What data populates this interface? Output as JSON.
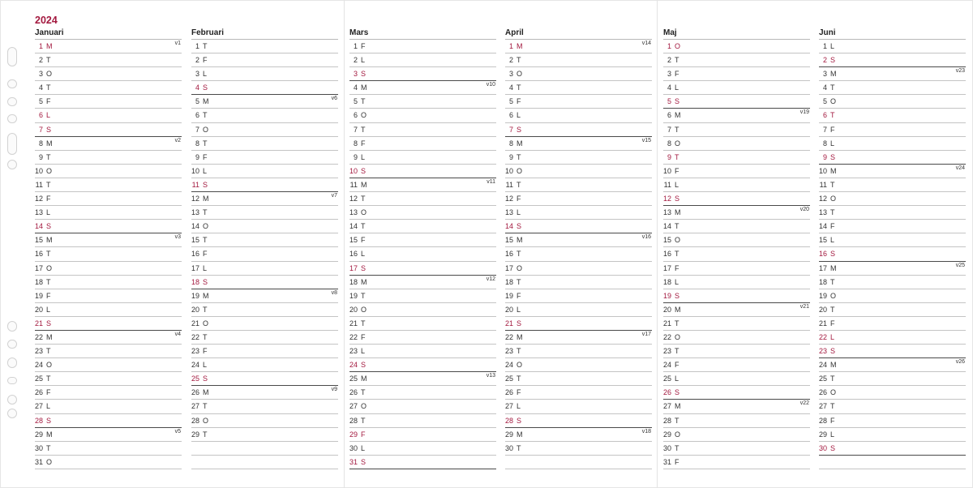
{
  "year": "2024",
  "colors": {
    "accent": "#a3193f",
    "text": "#333333"
  },
  "months": [
    {
      "name": "Januari",
      "days": [
        {
          "n": "1",
          "wd": "M",
          "red": true,
          "week": "v1"
        },
        {
          "n": "2",
          "wd": "T"
        },
        {
          "n": "3",
          "wd": "O"
        },
        {
          "n": "4",
          "wd": "T"
        },
        {
          "n": "5",
          "wd": "F"
        },
        {
          "n": "6",
          "wd": "L",
          "red": true
        },
        {
          "n": "7",
          "wd": "S",
          "red": true
        },
        {
          "n": "8",
          "wd": "M",
          "week": "v2"
        },
        {
          "n": "9",
          "wd": "T"
        },
        {
          "n": "10",
          "wd": "O"
        },
        {
          "n": "11",
          "wd": "T"
        },
        {
          "n": "12",
          "wd": "F"
        },
        {
          "n": "13",
          "wd": "L"
        },
        {
          "n": "14",
          "wd": "S",
          "red": true
        },
        {
          "n": "15",
          "wd": "M",
          "week": "v3"
        },
        {
          "n": "16",
          "wd": "T"
        },
        {
          "n": "17",
          "wd": "O"
        },
        {
          "n": "18",
          "wd": "T"
        },
        {
          "n": "19",
          "wd": "F"
        },
        {
          "n": "20",
          "wd": "L"
        },
        {
          "n": "21",
          "wd": "S",
          "red": true
        },
        {
          "n": "22",
          "wd": "M",
          "week": "v4"
        },
        {
          "n": "23",
          "wd": "T"
        },
        {
          "n": "24",
          "wd": "O"
        },
        {
          "n": "25",
          "wd": "T"
        },
        {
          "n": "26",
          "wd": "F"
        },
        {
          "n": "27",
          "wd": "L"
        },
        {
          "n": "28",
          "wd": "S",
          "red": true
        },
        {
          "n": "29",
          "wd": "M",
          "week": "v5"
        },
        {
          "n": "30",
          "wd": "T"
        },
        {
          "n": "31",
          "wd": "O"
        }
      ]
    },
    {
      "name": "Februari",
      "days": [
        {
          "n": "1",
          "wd": "T"
        },
        {
          "n": "2",
          "wd": "F"
        },
        {
          "n": "3",
          "wd": "L"
        },
        {
          "n": "4",
          "wd": "S",
          "red": true
        },
        {
          "n": "5",
          "wd": "M",
          "week": "v6"
        },
        {
          "n": "6",
          "wd": "T"
        },
        {
          "n": "7",
          "wd": "O"
        },
        {
          "n": "8",
          "wd": "T"
        },
        {
          "n": "9",
          "wd": "F"
        },
        {
          "n": "10",
          "wd": "L"
        },
        {
          "n": "11",
          "wd": "S",
          "red": true
        },
        {
          "n": "12",
          "wd": "M",
          "week": "v7"
        },
        {
          "n": "13",
          "wd": "T"
        },
        {
          "n": "14",
          "wd": "O"
        },
        {
          "n": "15",
          "wd": "T"
        },
        {
          "n": "16",
          "wd": "F"
        },
        {
          "n": "17",
          "wd": "L"
        },
        {
          "n": "18",
          "wd": "S",
          "red": true
        },
        {
          "n": "19",
          "wd": "M",
          "week": "v8"
        },
        {
          "n": "20",
          "wd": "T"
        },
        {
          "n": "21",
          "wd": "O"
        },
        {
          "n": "22",
          "wd": "T"
        },
        {
          "n": "23",
          "wd": "F"
        },
        {
          "n": "24",
          "wd": "L"
        },
        {
          "n": "25",
          "wd": "S",
          "red": true
        },
        {
          "n": "26",
          "wd": "M",
          "week": "v9"
        },
        {
          "n": "27",
          "wd": "T"
        },
        {
          "n": "28",
          "wd": "O"
        },
        {
          "n": "29",
          "wd": "T"
        }
      ]
    },
    {
      "name": "Mars",
      "days": [
        {
          "n": "1",
          "wd": "F"
        },
        {
          "n": "2",
          "wd": "L"
        },
        {
          "n": "3",
          "wd": "S",
          "red": true
        },
        {
          "n": "4",
          "wd": "M",
          "week": "v10"
        },
        {
          "n": "5",
          "wd": "T"
        },
        {
          "n": "6",
          "wd": "O"
        },
        {
          "n": "7",
          "wd": "T"
        },
        {
          "n": "8",
          "wd": "F"
        },
        {
          "n": "9",
          "wd": "L"
        },
        {
          "n": "10",
          "wd": "S",
          "red": true
        },
        {
          "n": "11",
          "wd": "M",
          "week": "v11"
        },
        {
          "n": "12",
          "wd": "T"
        },
        {
          "n": "13",
          "wd": "O"
        },
        {
          "n": "14",
          "wd": "T"
        },
        {
          "n": "15",
          "wd": "F"
        },
        {
          "n": "16",
          "wd": "L"
        },
        {
          "n": "17",
          "wd": "S",
          "red": true
        },
        {
          "n": "18",
          "wd": "M",
          "week": "v12"
        },
        {
          "n": "19",
          "wd": "T"
        },
        {
          "n": "20",
          "wd": "O"
        },
        {
          "n": "21",
          "wd": "T"
        },
        {
          "n": "22",
          "wd": "F"
        },
        {
          "n": "23",
          "wd": "L"
        },
        {
          "n": "24",
          "wd": "S",
          "red": true
        },
        {
          "n": "25",
          "wd": "M",
          "week": "v13"
        },
        {
          "n": "26",
          "wd": "T"
        },
        {
          "n": "27",
          "wd": "O"
        },
        {
          "n": "28",
          "wd": "T"
        },
        {
          "n": "29",
          "wd": "F",
          "red": true
        },
        {
          "n": "30",
          "wd": "L"
        },
        {
          "n": "31",
          "wd": "S",
          "red": true
        }
      ]
    },
    {
      "name": "April",
      "days": [
        {
          "n": "1",
          "wd": "M",
          "red": true,
          "week": "v14"
        },
        {
          "n": "2",
          "wd": "T"
        },
        {
          "n": "3",
          "wd": "O"
        },
        {
          "n": "4",
          "wd": "T"
        },
        {
          "n": "5",
          "wd": "F"
        },
        {
          "n": "6",
          "wd": "L"
        },
        {
          "n": "7",
          "wd": "S",
          "red": true
        },
        {
          "n": "8",
          "wd": "M",
          "week": "v15"
        },
        {
          "n": "9",
          "wd": "T"
        },
        {
          "n": "10",
          "wd": "O"
        },
        {
          "n": "11",
          "wd": "T"
        },
        {
          "n": "12",
          "wd": "F"
        },
        {
          "n": "13",
          "wd": "L"
        },
        {
          "n": "14",
          "wd": "S",
          "red": true
        },
        {
          "n": "15",
          "wd": "M",
          "week": "v16"
        },
        {
          "n": "16",
          "wd": "T"
        },
        {
          "n": "17",
          "wd": "O"
        },
        {
          "n": "18",
          "wd": "T"
        },
        {
          "n": "19",
          "wd": "F"
        },
        {
          "n": "20",
          "wd": "L"
        },
        {
          "n": "21",
          "wd": "S",
          "red": true
        },
        {
          "n": "22",
          "wd": "M",
          "week": "v17"
        },
        {
          "n": "23",
          "wd": "T"
        },
        {
          "n": "24",
          "wd": "O"
        },
        {
          "n": "25",
          "wd": "T"
        },
        {
          "n": "26",
          "wd": "F"
        },
        {
          "n": "27",
          "wd": "L"
        },
        {
          "n": "28",
          "wd": "S",
          "red": true
        },
        {
          "n": "29",
          "wd": "M",
          "week": "v18"
        },
        {
          "n": "30",
          "wd": "T"
        }
      ]
    },
    {
      "name": "Maj",
      "days": [
        {
          "n": "1",
          "wd": "O",
          "red": true
        },
        {
          "n": "2",
          "wd": "T"
        },
        {
          "n": "3",
          "wd": "F"
        },
        {
          "n": "4",
          "wd": "L"
        },
        {
          "n": "5",
          "wd": "S",
          "red": true
        },
        {
          "n": "6",
          "wd": "M",
          "week": "v19"
        },
        {
          "n": "7",
          "wd": "T"
        },
        {
          "n": "8",
          "wd": "O"
        },
        {
          "n": "9",
          "wd": "T",
          "red": true
        },
        {
          "n": "10",
          "wd": "F"
        },
        {
          "n": "11",
          "wd": "L"
        },
        {
          "n": "12",
          "wd": "S",
          "red": true
        },
        {
          "n": "13",
          "wd": "M",
          "week": "v20"
        },
        {
          "n": "14",
          "wd": "T"
        },
        {
          "n": "15",
          "wd": "O"
        },
        {
          "n": "16",
          "wd": "T"
        },
        {
          "n": "17",
          "wd": "F"
        },
        {
          "n": "18",
          "wd": "L"
        },
        {
          "n": "19",
          "wd": "S",
          "red": true
        },
        {
          "n": "20",
          "wd": "M",
          "week": "v21"
        },
        {
          "n": "21",
          "wd": "T"
        },
        {
          "n": "22",
          "wd": "O"
        },
        {
          "n": "23",
          "wd": "T"
        },
        {
          "n": "24",
          "wd": "F"
        },
        {
          "n": "25",
          "wd": "L"
        },
        {
          "n": "26",
          "wd": "S",
          "red": true
        },
        {
          "n": "27",
          "wd": "M",
          "week": "v22"
        },
        {
          "n": "28",
          "wd": "T"
        },
        {
          "n": "29",
          "wd": "O"
        },
        {
          "n": "30",
          "wd": "T"
        },
        {
          "n": "31",
          "wd": "F"
        }
      ]
    },
    {
      "name": "Juni",
      "days": [
        {
          "n": "1",
          "wd": "L"
        },
        {
          "n": "2",
          "wd": "S",
          "red": true
        },
        {
          "n": "3",
          "wd": "M",
          "week": "v23"
        },
        {
          "n": "4",
          "wd": "T"
        },
        {
          "n": "5",
          "wd": "O"
        },
        {
          "n": "6",
          "wd": "T",
          "red": true
        },
        {
          "n": "7",
          "wd": "F"
        },
        {
          "n": "8",
          "wd": "L"
        },
        {
          "n": "9",
          "wd": "S",
          "red": true
        },
        {
          "n": "10",
          "wd": "M",
          "week": "v24"
        },
        {
          "n": "11",
          "wd": "T"
        },
        {
          "n": "12",
          "wd": "O"
        },
        {
          "n": "13",
          "wd": "T"
        },
        {
          "n": "14",
          "wd": "F"
        },
        {
          "n": "15",
          "wd": "L"
        },
        {
          "n": "16",
          "wd": "S",
          "red": true
        },
        {
          "n": "17",
          "wd": "M",
          "week": "v25"
        },
        {
          "n": "18",
          "wd": "T"
        },
        {
          "n": "19",
          "wd": "O"
        },
        {
          "n": "20",
          "wd": "T"
        },
        {
          "n": "21",
          "wd": "F"
        },
        {
          "n": "22",
          "wd": "L",
          "red": true
        },
        {
          "n": "23",
          "wd": "S",
          "red": true
        },
        {
          "n": "24",
          "wd": "M",
          "week": "v26"
        },
        {
          "n": "25",
          "wd": "T"
        },
        {
          "n": "26",
          "wd": "O"
        },
        {
          "n": "27",
          "wd": "T"
        },
        {
          "n": "28",
          "wd": "F"
        },
        {
          "n": "29",
          "wd": "L"
        },
        {
          "n": "30",
          "wd": "S",
          "red": true
        }
      ]
    }
  ]
}
